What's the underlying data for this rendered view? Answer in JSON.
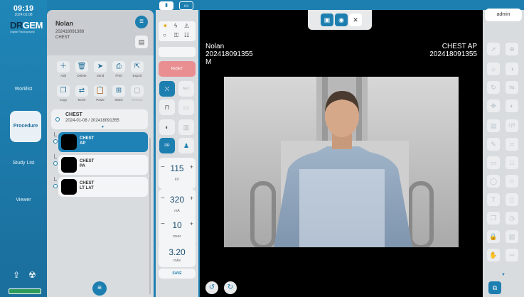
{
  "clock": {
    "time": "09:19",
    "date": "2024.01.08"
  },
  "logo": {
    "text1": "DR",
    "text2": "GEM",
    "sub": "Digital Radiography"
  },
  "nav": [
    "Worklist",
    "Procedure",
    "Study List",
    "Viewer"
  ],
  "patient": {
    "name": "Nolan",
    "id": "202418091388",
    "exam": "CHEST"
  },
  "tools_row1": [
    "Add",
    "Delete",
    "Send",
    "Print",
    "Export"
  ],
  "tools_row2": [
    "Copy",
    "Move",
    "Paste",
    "Stitch",
    "Restore"
  ],
  "study": {
    "title": "CHEST",
    "date_id": "2024-01-08 / 202418091355"
  },
  "series": [
    {
      "l1": "CHEST",
      "l2": "AP"
    },
    {
      "l1": "CHEST",
      "l2": "PA"
    },
    {
      "l1": "CHEST",
      "l2": "LT LAT"
    }
  ],
  "exposure": {
    "reset": "RESET",
    "kv": {
      "value": "115",
      "unit": "kV"
    },
    "ma": {
      "value": "320",
      "unit": "mA"
    },
    "msec": {
      "value": "10",
      "unit": "msec"
    },
    "mas": {
      "value": "3.20",
      "unit": "mAs"
    },
    "save": "SAVE",
    "aec_label": "AEC",
    "dr_label": "DR"
  },
  "viewer": {
    "name": "Nolan",
    "id": "202418091355",
    "sex": "M",
    "exam": "CHEST AP",
    "exam_id": "202418091355"
  },
  "user": "admin",
  "colors": {
    "accent": "#1d7fb0",
    "reset": "#e98f92"
  }
}
